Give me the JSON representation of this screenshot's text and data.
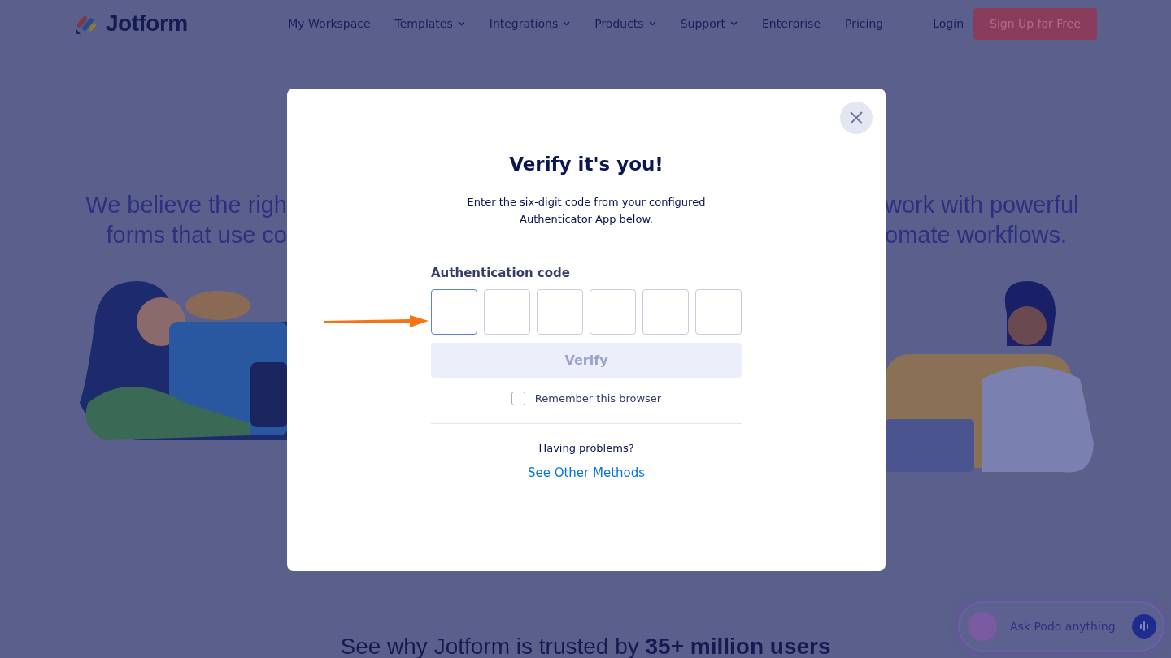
{
  "header": {
    "logo": "Jotform",
    "nav": [
      {
        "label": "My Workspace",
        "dropdown": false
      },
      {
        "label": "Templates",
        "dropdown": true
      },
      {
        "label": "Integrations",
        "dropdown": true
      },
      {
        "label": "Products",
        "dropdown": true
      },
      {
        "label": "Support",
        "dropdown": true
      },
      {
        "label": "Enterprise",
        "dropdown": false
      },
      {
        "label": "Pricing",
        "dropdown": false
      }
    ],
    "login": "Login",
    "signup": "Sign Up for Free"
  },
  "hero": {
    "left_lines": [
      "We believe the righ",
      "forms that use co"
    ],
    "right_lines": [
      "work with powerful",
      "omate workflows."
    ]
  },
  "trust": "See why Jotform is trusted by **35+ million users**",
  "chat": {
    "placeholder": "Ask Podo anything"
  },
  "dialog": {
    "title": "Verify it's you!",
    "description_lines": [
      "Enter the six-digit code from your configured",
      "Authenticator App below."
    ],
    "code_label": "Authentication code",
    "code_fields": [
      {
        "focused": true
      },
      {
        "focused": false
      },
      {
        "focused": false
      },
      {
        "focused": false
      },
      {
        "focused": false
      },
      {
        "focused": false
      }
    ],
    "verify": {
      "label": "Verify",
      "disabled": true
    },
    "remember": {
      "label": "Remember this browser",
      "checked": false
    },
    "problems": "Having problems?",
    "link": "See Other Methods"
  }
}
